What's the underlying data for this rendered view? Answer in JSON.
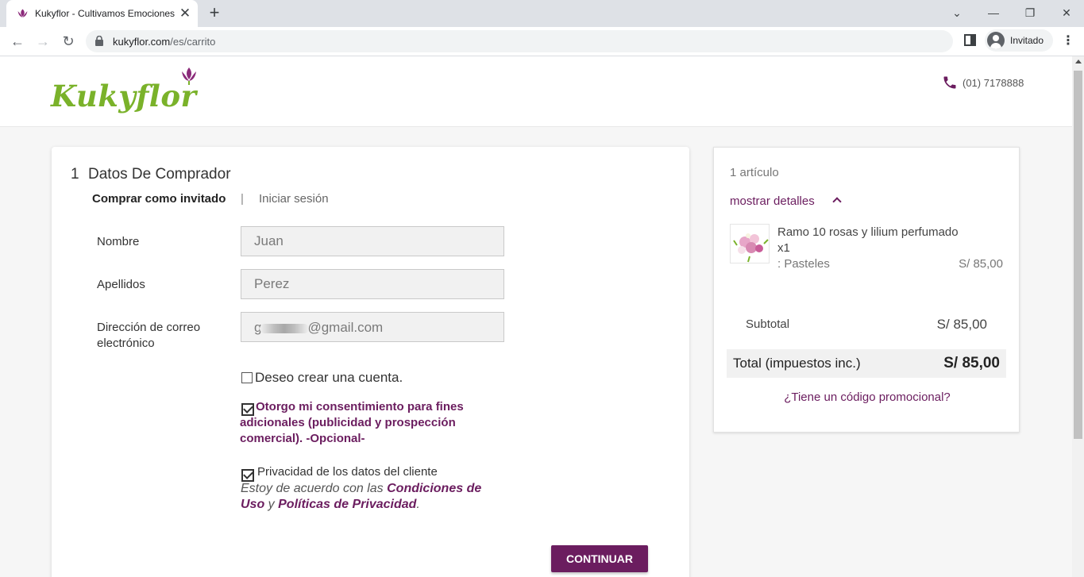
{
  "browser": {
    "tab_title": "Kukyflor - Cultivamos Emociones",
    "tab_close": "✕",
    "new_tab": "+",
    "url_domain": "kukyflor.com",
    "url_path": "/es/carrito",
    "profile_label": "Invitado",
    "window_controls": {
      "dropdown": "⌄",
      "minimize": "—",
      "restore": "❐",
      "close": "✕"
    },
    "nav": {
      "back": "←",
      "forward": "→",
      "reload": "↻"
    },
    "menu": "⋮"
  },
  "header": {
    "logo_text": "Kukyflor",
    "phone": "(01) 7178888"
  },
  "checkout": {
    "step_number": "1",
    "step_title": "Datos De Comprador",
    "guest_tab": "Comprar como invitado",
    "separator": "|",
    "login_tab": "Iniciar sesión",
    "fields": {
      "first_name_label": "Nombre",
      "first_name_value": "Juan",
      "last_name_label": "Apellidos",
      "last_name_value": "Perez",
      "email_label": "Dirección de correo electrónico",
      "email_prefix": "g",
      "email_suffix": "@gmail.com"
    },
    "create_account_label": "Deseo crear una cuenta.",
    "create_account_checked": false,
    "consent_label": "Otorgo mi consentimiento para fines adicionales (publicidad y prospección comercial). -Opcional-",
    "consent_checked": true,
    "privacy_title": "Privacidad de los datos del cliente",
    "privacy_checked": true,
    "privacy_text_1": "Estoy de acuerdo con las ",
    "privacy_link_1": "Condiciones de Uso",
    "privacy_text_2": " y ",
    "privacy_link_2": "Políticas de Privacidad",
    "privacy_text_3": ".",
    "continue_label": "CONTINUAR"
  },
  "summary": {
    "item_count": "1 artículo",
    "details_toggle": "mostrar detalles",
    "product": {
      "name": "Ramo 10 rosas y lilium perfumado",
      "quantity": "x1",
      "attribute": ": Pasteles",
      "price": "S/ 85,00"
    },
    "subtotal_label": "Subtotal",
    "subtotal_value": "S/ 85,00",
    "total_label": "Total (impuestos inc.)",
    "total_value": "S/ 85,00",
    "promo_link": "¿Tiene un código promocional?"
  },
  "colors": {
    "brand_purple": "#6b1d5f",
    "brand_green": "#7ab22a"
  }
}
